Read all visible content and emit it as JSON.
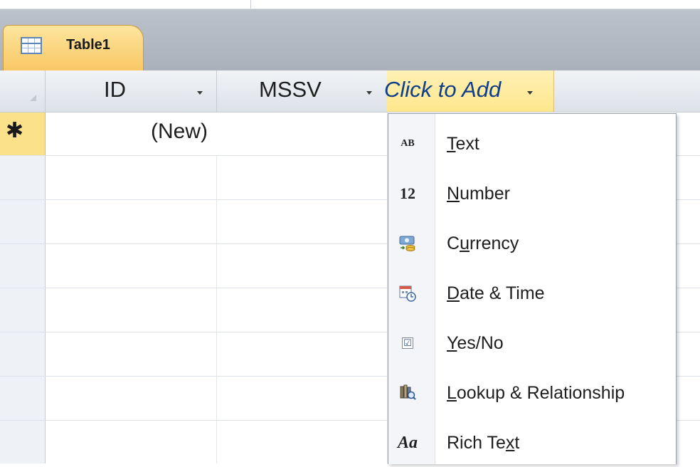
{
  "tab": {
    "label": "Table1",
    "icon": "table-icon"
  },
  "columns": [
    {
      "label": "ID"
    },
    {
      "label": "MSSV"
    },
    {
      "label": "Click to Add"
    }
  ],
  "new_row": {
    "marker": "✱",
    "id_value": "(New)"
  },
  "menu": {
    "items": [
      {
        "pre": "",
        "mnemonic": "T",
        "post": "ext",
        "icon": "text-type-icon",
        "icon_text": "AB"
      },
      {
        "pre": "",
        "mnemonic": "N",
        "post": "umber",
        "icon": "number-type-icon",
        "icon_text": "12"
      },
      {
        "pre": "C",
        "mnemonic": "u",
        "post": "rrency",
        "icon": "currency-type-icon"
      },
      {
        "pre": "",
        "mnemonic": "D",
        "post": "ate & Time",
        "icon": "date-time-type-icon"
      },
      {
        "pre": "",
        "mnemonic": "Y",
        "post": "es/No",
        "icon": "yes-no-type-icon",
        "icon_text": "☑"
      },
      {
        "pre": "",
        "mnemonic": "L",
        "post": "ookup & Relationship",
        "icon": "lookup-type-icon"
      },
      {
        "pre": "Rich Te",
        "mnemonic": "x",
        "post": "t",
        "icon": "rich-text-type-icon",
        "icon_text": "Aa"
      }
    ]
  },
  "colors": {
    "tab_active": "#f8c764",
    "click_to_add_bg": "#fde78d",
    "click_to_add_text": "#103e8a",
    "tab_bar": "#aab1bb"
  }
}
